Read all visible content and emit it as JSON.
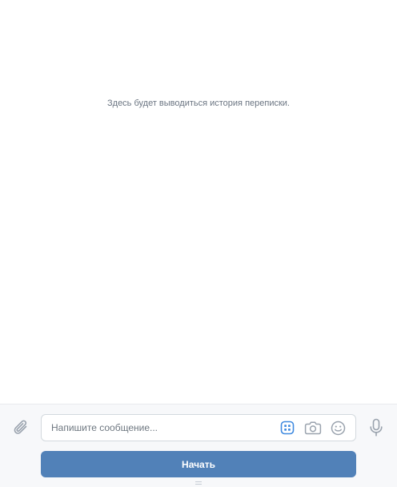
{
  "history": {
    "empty_text": "Здесь будет выводиться история переписки."
  },
  "composer": {
    "placeholder": "Напишите сообщение...",
    "value": "",
    "icons": {
      "attach": "paperclip-icon",
      "keyboard": "bot-keyboard-icon",
      "camera": "camera-icon",
      "emoji": "emoji-icon",
      "mic": "microphone-icon"
    }
  },
  "actions": {
    "start_label": "Начать"
  },
  "colors": {
    "accent": "#5181b8",
    "icon": "#99a2ad",
    "keyboard_icon": "#3f8ae0",
    "background": "#ffffff",
    "composer_background": "#f7f8fa",
    "muted_text": "#6b7582"
  }
}
